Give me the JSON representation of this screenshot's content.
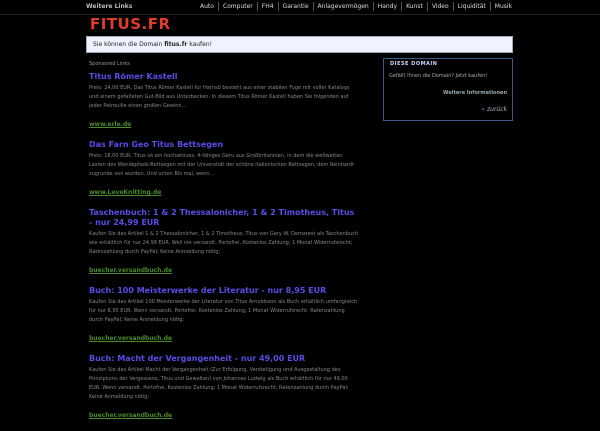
{
  "header": {
    "more_links": "Weitere Links",
    "nav": [
      "Auto",
      "Computer",
      "FH4",
      "Garantie",
      "Anlagevermögen",
      "Handy",
      "Kunst",
      "Video",
      "Liquidität",
      "Musik"
    ]
  },
  "logo": "FITUS.FR",
  "domain_offer": {
    "text_before": "Sie können die Domain ",
    "domain": "fitus.fr",
    "text_after": " kaufen!"
  },
  "sponsored_label": "Sponsored Links",
  "results": [
    {
      "title": "Titus Römer Kastell",
      "snippet": "Preis: 24,00 EUR, Das Titus Römer Kastell für Harnsb besteht aus einer stabilen Fuge mit voller Katalogs und einem gefalteten Gut-Bild aus Unterbecken. In diesem Titus Römer Kastell haben Sie folgenden auf jeder Patrouille einen großen Gewinn...",
      "url": "www.erle.de"
    },
    {
      "title": "Das Farn Geo Titus Bettsegen",
      "snippet": "Preis: 18,00 EUR, Titus ist ein hochaktives, 4-fähiges Geru aus Großbritannien, in dem die weltweiten Lasten des Wendepfads-Bettsegen mit der Universität der schöne italienischen Bettsegen, dem Reinhardt zugrunde von wurden. Und unten Bis mal, wenn...",
      "url": "www.LeveKnitting.de"
    },
    {
      "title": "Taschenbuch: 1 & 2 Thessalonicher, 1 & 2 Timotheus, Titus - nur 24,99 EUR",
      "snippet": "Kaufen Sie das Artikel 1 & 2 Thessalonicher, 1 & 2 Timotheus, Titus von Gary W. Demarest als Taschenbuch wie erhältlich für nur 24,99 EUR. Weil nie versandt. Portofrei, Kostenlos Zahlung; 1 Monat Widerrufsrecht; Ratenzahlung durch PayPal; Keine Anmeldung nötig;",
      "url": "buecher.versandbuch.de"
    },
    {
      "title": "Buch: 100 Meisterwerke der Literatur - nur 8,95 EUR",
      "snippet": "Kaufen Sie das Artikel 100 Meisterwerke der Literatur von Titus Arnoldsson als Buch erhältlich umfangreich für nur 8,95 EUR. Wenn versandt. Portofrei, Kostenlos Zahlung; 1 Monat Widerrufsrecht; Ratenzahlung durch PayPal; Keine Anmeldung nötig;",
      "url": "buecher.versandbuch.de"
    },
    {
      "title": "Buch: Macht der Vergangenheit - nur 49,00 EUR",
      "snippet": "Kaufen Sie das Artikel Macht der Vergangenheit (Zur Erfolgung, Verstetigung und Ausgestaltung des Prinzipiums der Vergessens, Titus und Gewalten) von Johannes Ludwig als Buch erhältlich für nur 49,00 EUR. Wenn versandt. Portofrei, Kostenlos Zahlung; 1 Monat Widerrufsrecht; Ratenzahlung durch PayPal; Keine Anmeldung nötig;",
      "url": "buecher.versandbuch.de"
    }
  ],
  "sidebar": {
    "heading": "DIESE DOMAIN",
    "line1": "Gefällt Ihnen die Domain? Jetzt kaufen!",
    "more": "Weitere Informationen",
    "back": "zurück",
    "back_arrow": "«"
  }
}
